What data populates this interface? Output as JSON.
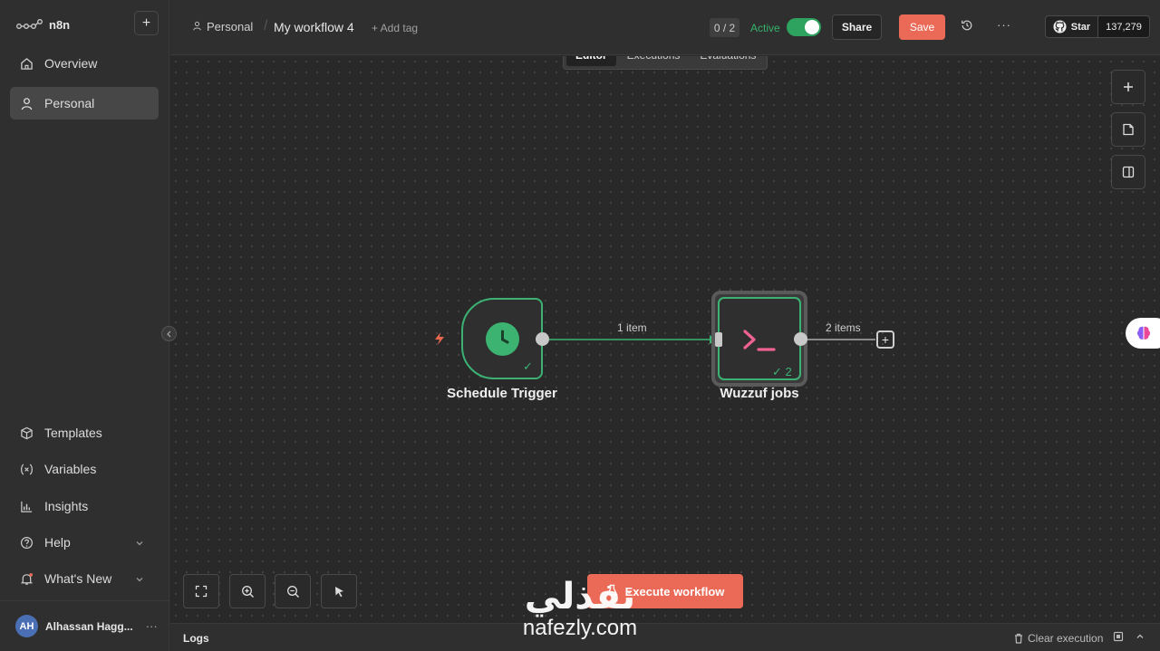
{
  "brand": {
    "name": "n8n"
  },
  "sidebar": {
    "items": [
      {
        "label": "Overview",
        "icon": "home-icon"
      },
      {
        "label": "Personal",
        "icon": "user-icon",
        "active": true
      }
    ],
    "bottom_items": [
      {
        "label": "Templates",
        "icon": "box-icon"
      },
      {
        "label": "Variables",
        "icon": "variable-icon"
      },
      {
        "label": "Insights",
        "icon": "chart-icon"
      },
      {
        "label": "Help",
        "icon": "help-icon"
      },
      {
        "label": "What's New",
        "icon": "bell-icon"
      }
    ],
    "user": {
      "initials": "AH",
      "name": "Alhassan Hagg...",
      "more": "···"
    }
  },
  "header": {
    "breadcrumb": "Personal",
    "separator": "/",
    "workflow_title": "My workflow 4",
    "add_tag": "+ Add tag",
    "counter": "0 / 2",
    "active_label": "Active",
    "share_label": "Share",
    "save_label": "Save",
    "more": "···"
  },
  "github": {
    "star_label": "Star",
    "count": "137,279"
  },
  "tabs": [
    {
      "label": "Editor",
      "active": true
    },
    {
      "label": "Executions"
    },
    {
      "label": "Evaluations"
    }
  ],
  "nodes": {
    "trigger": {
      "label": "Schedule Trigger",
      "check": "✓"
    },
    "code": {
      "label": "Wuzzuf jobs",
      "check": "✓ 2"
    }
  },
  "edges": {
    "first": "1 item",
    "second": "2 items"
  },
  "execute_label": "Execute workflow",
  "logs": {
    "title": "Logs",
    "clear_label": "Clear execution"
  },
  "watermark": {
    "arabic": "نفذلي",
    "latin": "nafezly.com"
  },
  "colors": {
    "accent": "#ea6a57",
    "success": "#3bb273",
    "canvas": "#292929"
  }
}
